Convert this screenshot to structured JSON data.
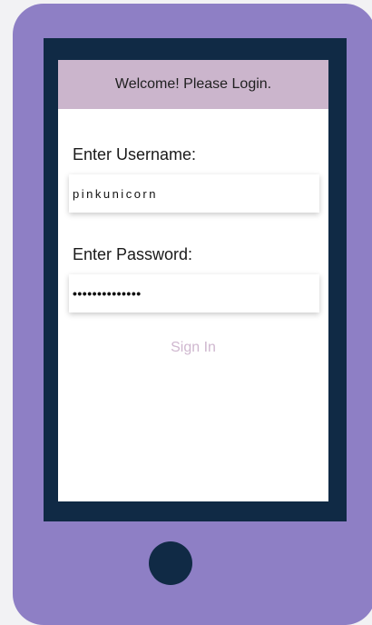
{
  "header": {
    "title": "Welcome! Please Login."
  },
  "form": {
    "username_label": "Enter Username:",
    "username_value": "pinkunicorn",
    "password_label": "Enter Password:",
    "password_masked": "••••••••••••••",
    "signin_label": "Sign In"
  },
  "colors": {
    "phone_body": "#8e7fc5",
    "bezel": "#102a45",
    "header_bg": "#cbb5cc",
    "signin_text": "#cfb7cf"
  },
  "icons": {
    "home": "home-button-circle"
  }
}
